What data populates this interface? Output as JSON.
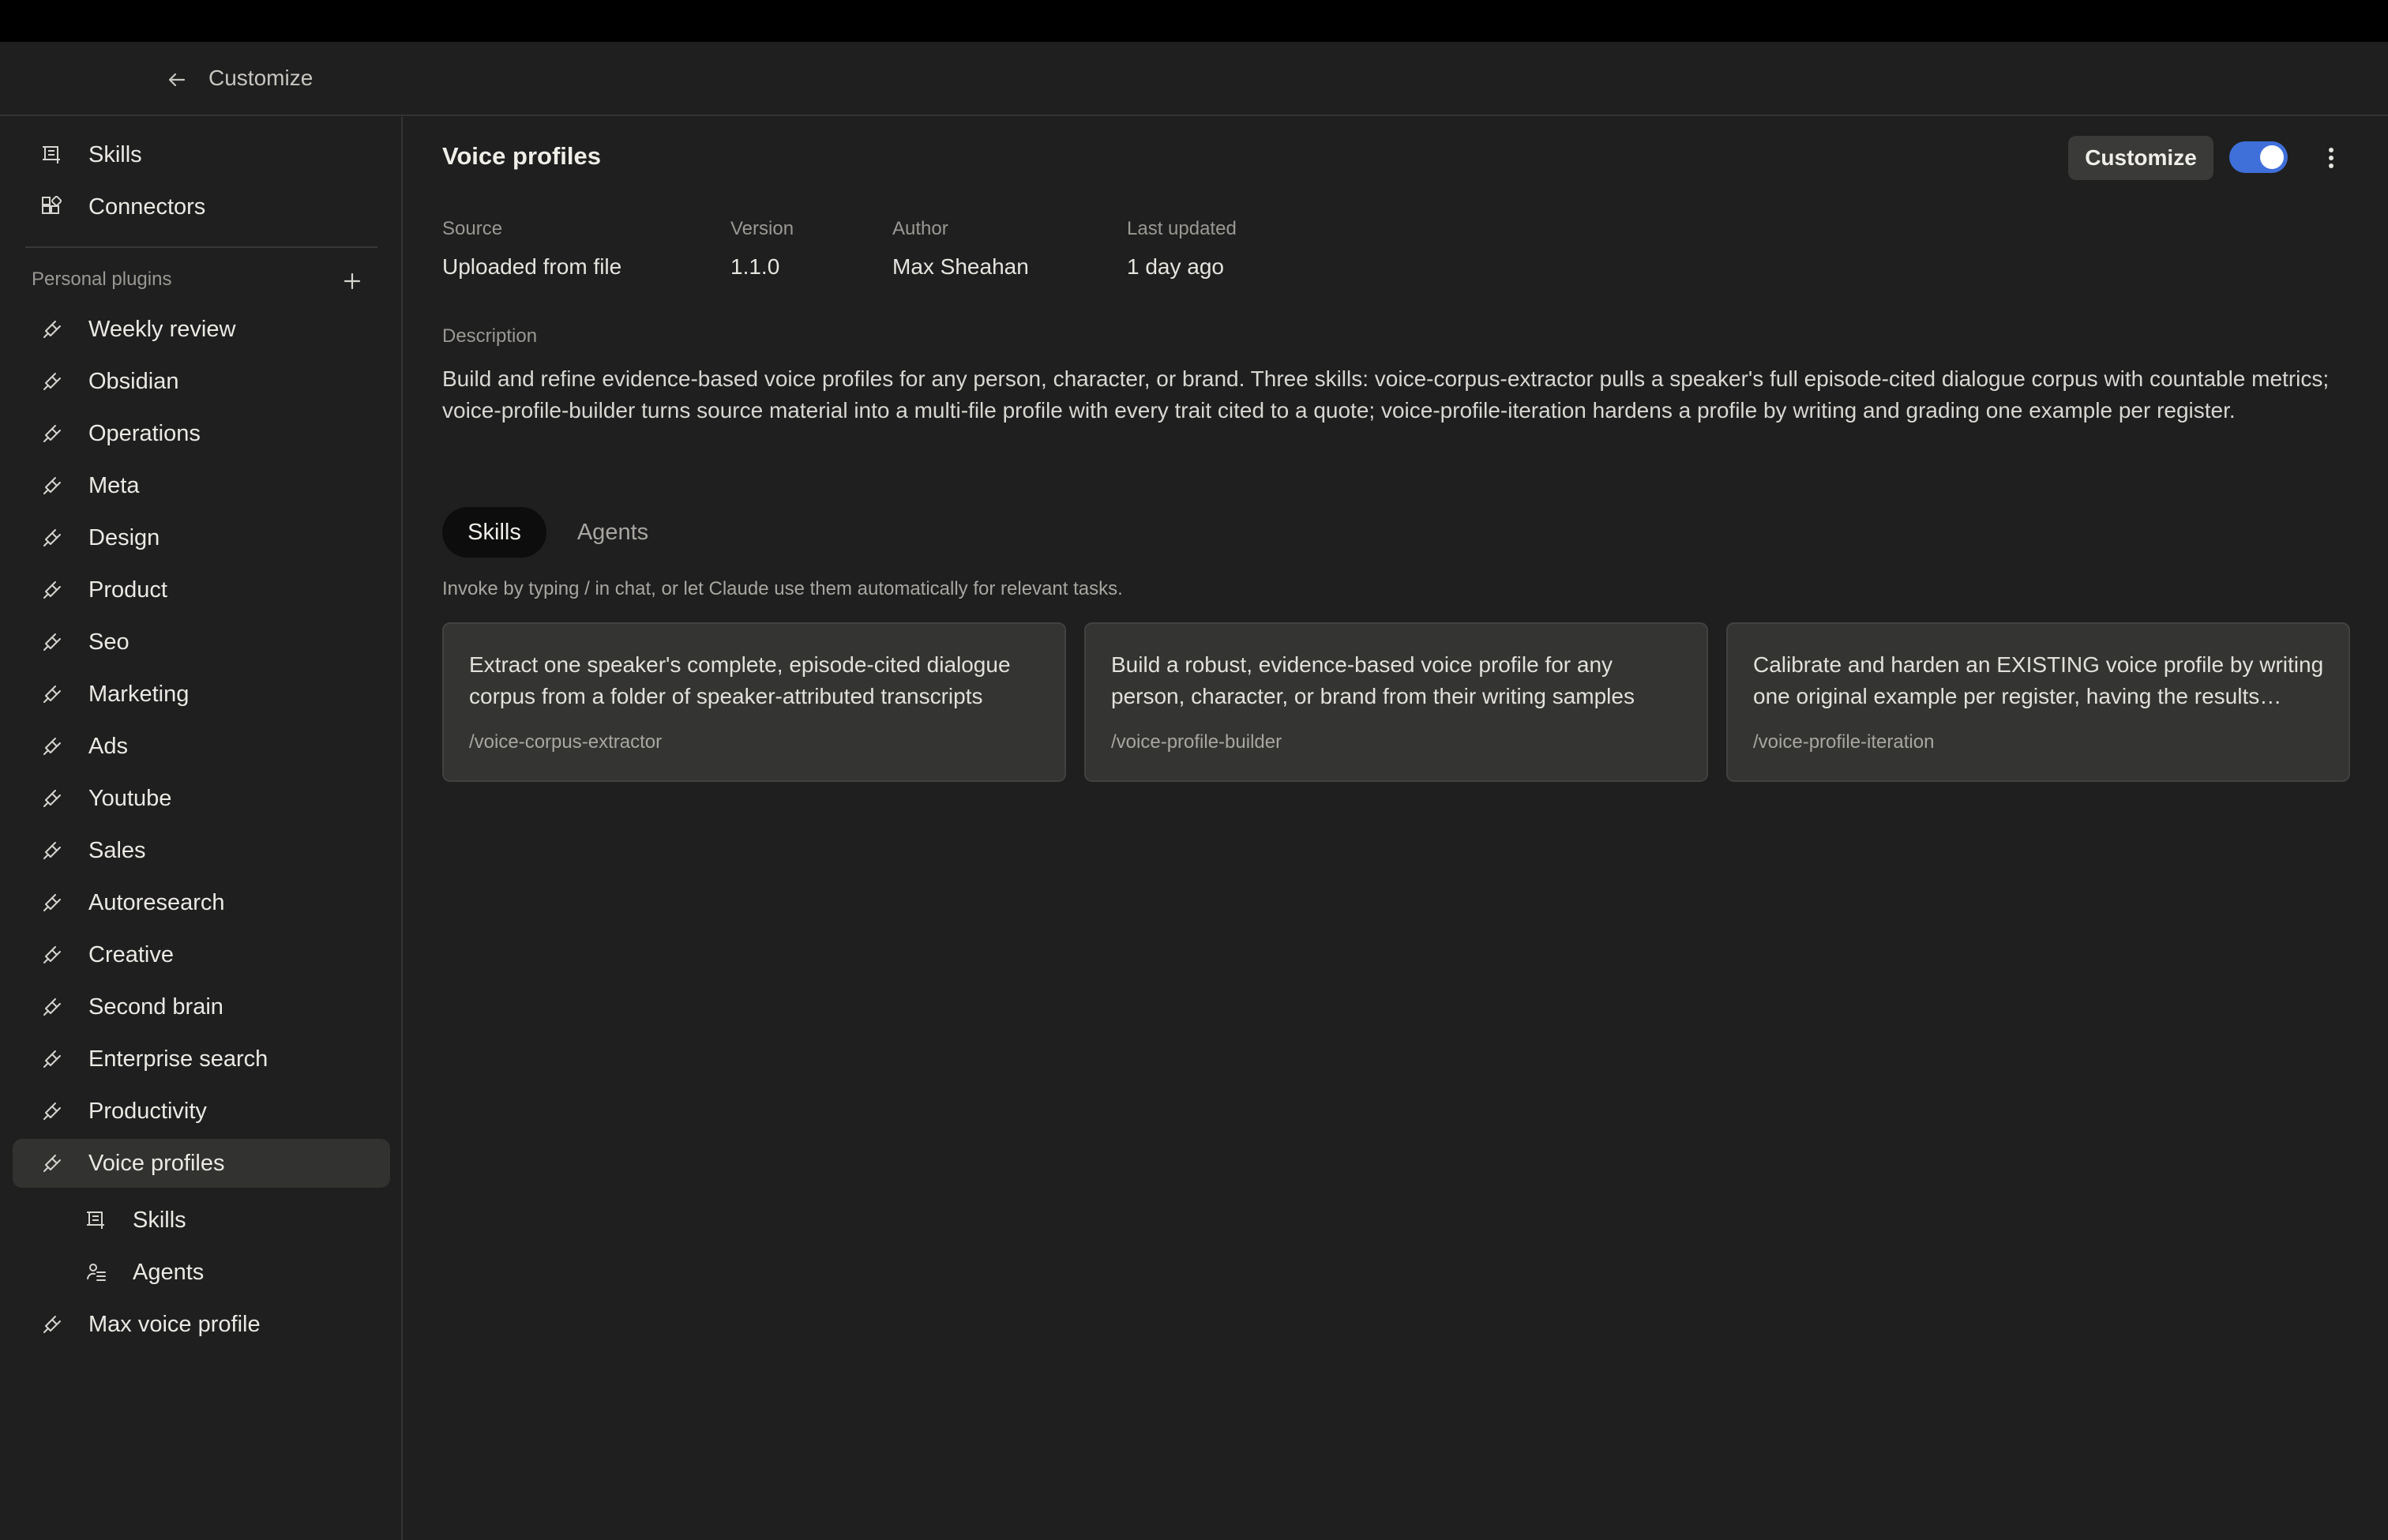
{
  "header": {
    "title": "Customize"
  },
  "sidebar": {
    "top_items": [
      {
        "label": "Skills",
        "icon": "skills-icon"
      },
      {
        "label": "Connectors",
        "icon": "connectors-icon"
      }
    ],
    "section_label": "Personal plugins",
    "plugins": [
      "Weekly review",
      "Obsidian",
      "Operations",
      "Meta",
      "Design",
      "Product",
      "Seo",
      "Marketing",
      "Ads",
      "Youtube",
      "Sales",
      "Autoresearch",
      "Creative",
      "Second brain",
      "Enterprise search",
      "Productivity",
      "Voice profiles"
    ],
    "active_plugin": "Voice profiles",
    "sub_items": [
      {
        "label": "Skills",
        "icon": "skills-icon"
      },
      {
        "label": "Agents",
        "icon": "agents-icon"
      }
    ],
    "last_plugin": "Max voice profile"
  },
  "main": {
    "title": "Voice profiles",
    "customize_label": "Customize",
    "enabled": true,
    "meta": [
      {
        "key": "Source",
        "value": "Uploaded from file"
      },
      {
        "key": "Version",
        "value": "1.1.0"
      },
      {
        "key": "Author",
        "value": "Max Sheahan"
      },
      {
        "key": "Last updated",
        "value": "1 day ago"
      }
    ],
    "description_label": "Description",
    "description": "Build and refine evidence-based voice profiles for any person, character, or brand. Three skills: voice-corpus-extractor pulls a speaker's full episode-cited dialogue corpus with countable metrics; voice-profile-builder turns source material into a multi-file profile with every trait cited to a quote; voice-profile-iteration hardens a profile by writing and grading one example per register.",
    "tabs": [
      {
        "label": "Skills",
        "active": true
      },
      {
        "label": "Agents",
        "active": false
      }
    ],
    "hint": "Invoke by typing / in chat, or let Claude use them automatically for relevant tasks.",
    "skills": [
      {
        "text": "Extract one speaker's complete, episode-cited dialogue corpus from a folder of speaker-attributed transcripts",
        "command": "/voice-corpus-extractor"
      },
      {
        "text": "Build a robust, evidence-based voice profile for any person, character, or brand from their writing samples",
        "command": "/voice-profile-builder"
      },
      {
        "text": "Calibrate and harden an EXISTING voice profile by writing one original example per register, having the results graded",
        "command": "/voice-profile-iteration"
      }
    ]
  },
  "colors": {
    "accent": "#3f6fd9",
    "background": "#1f1f1f"
  }
}
